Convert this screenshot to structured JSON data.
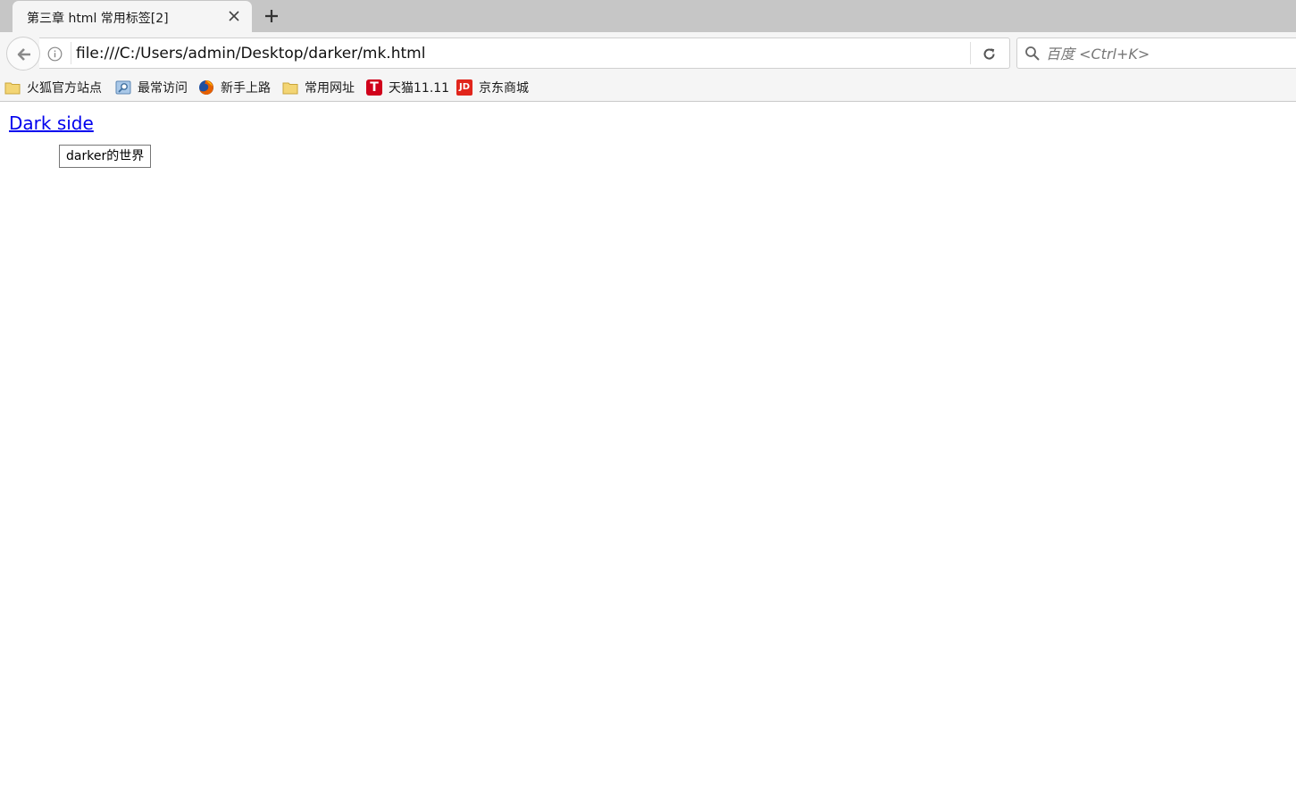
{
  "tab": {
    "title": "第三章 html 常用标签[2]",
    "close_icon": "close-icon",
    "new_tab_icon": "plus-icon"
  },
  "navbar": {
    "back_icon": "back-arrow-icon",
    "info_icon": "info-icon",
    "url": "file:///C:/Users/admin/Desktop/darker/mk.html",
    "reload_icon": "reload-icon"
  },
  "search": {
    "placeholder": "百度 <Ctrl+K>",
    "icon": "search-icon"
  },
  "bookmarks": [
    {
      "label": "火狐官方站点",
      "icon": "folder-icon"
    },
    {
      "label": "最常访问",
      "icon": "smart-folder-icon"
    },
    {
      "label": "新手上路",
      "icon": "firefox-icon"
    },
    {
      "label": "常用网址",
      "icon": "folder-icon"
    },
    {
      "label": "天猫11.11",
      "icon": "tmall-icon",
      "icon_text": "T"
    },
    {
      "label": "京东商城",
      "icon": "jd-icon",
      "icon_text": "JD"
    }
  ],
  "page": {
    "link_text": "Dark side",
    "tooltip_text": "darker的世界"
  },
  "colors": {
    "link": "#0000ee",
    "tab_strip": "#c6c6c6",
    "toolbar": "#f5f5f5",
    "tmall_red": "#d0021b",
    "jd_red": "#e1251b"
  }
}
